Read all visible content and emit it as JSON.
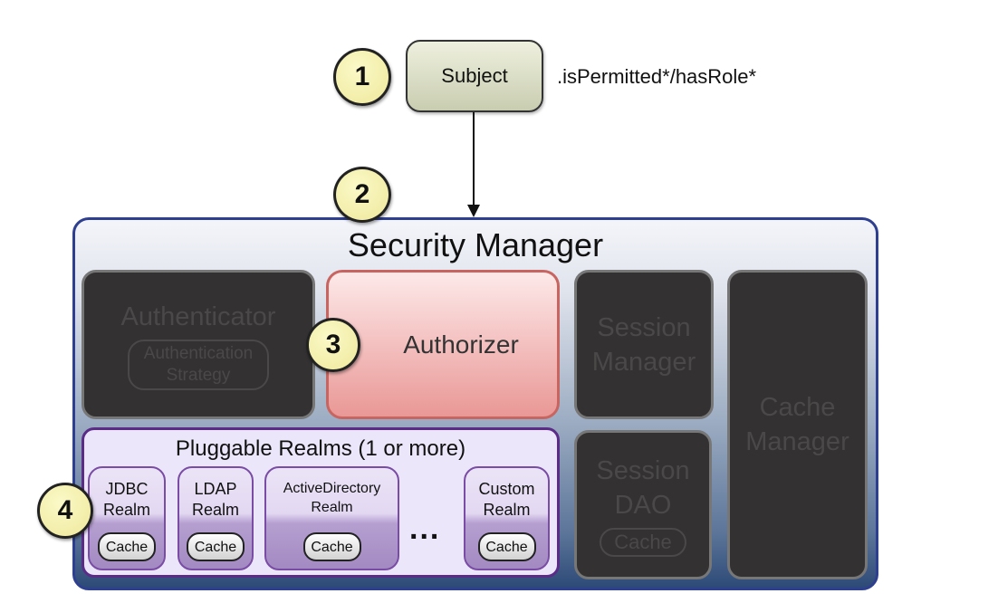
{
  "steps": [
    "1",
    "2",
    "3",
    "4"
  ],
  "subject": {
    "label": "Subject",
    "method": ".isPermitted*/hasRole*"
  },
  "security_manager": {
    "title": "Security Manager",
    "authenticator": {
      "label": "Authenticator",
      "strategy": "Authentication Strategy"
    },
    "authorizer": {
      "label": "Authorizer"
    },
    "session_manager": {
      "label": "Session Manager"
    },
    "session_dao": {
      "label": "Session DAO",
      "cache": "Cache"
    },
    "cache_manager": {
      "label": "Cache Manager"
    },
    "realms": {
      "title": "Pluggable Realms (1 or more)",
      "items": [
        {
          "line1": "JDBC",
          "line2": "Realm",
          "cache": "Cache"
        },
        {
          "line1": "LDAP",
          "line2": "Realm",
          "cache": "Cache"
        },
        {
          "line1": "ActiveDirectory",
          "line2": "Realm",
          "cache": "Cache"
        },
        {
          "line1": "Custom",
          "line2": "Realm",
          "cache": "Cache"
        }
      ],
      "ellipsis": "..."
    }
  },
  "colors": {
    "highlight": "#e99896",
    "inactive": "#333132",
    "circle": "#eee89a",
    "manager_border": "#2e3f8f",
    "realms_border": "#5a2c87"
  }
}
